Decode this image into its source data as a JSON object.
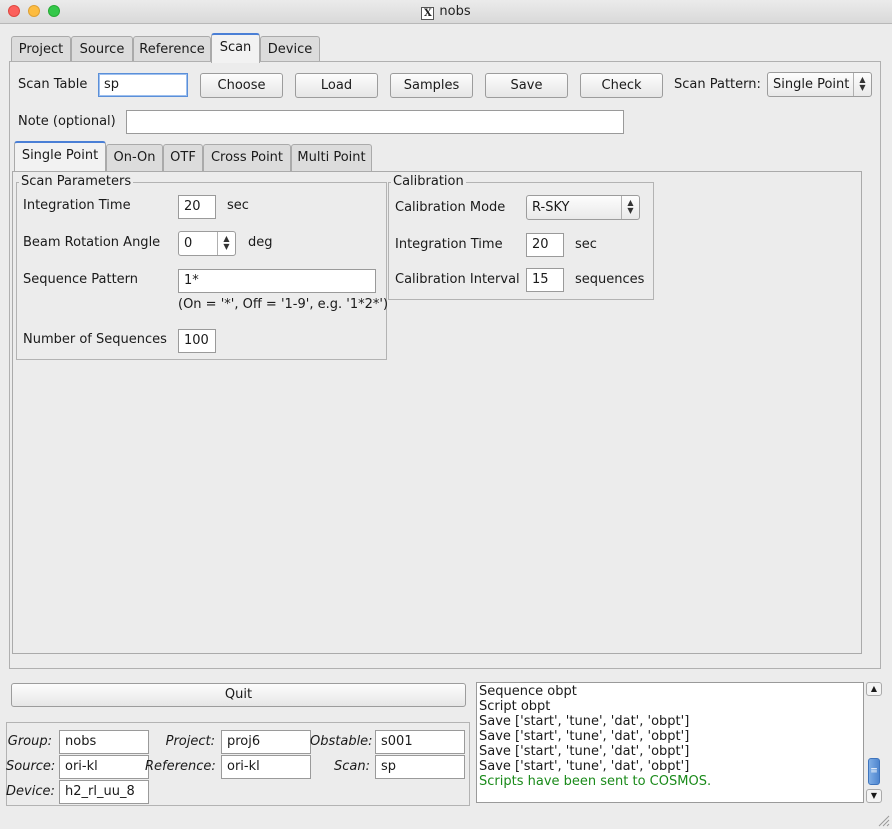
{
  "window": {
    "title": "nobs",
    "app_icon": "x11-icon"
  },
  "main_tabs": [
    "Project",
    "Source",
    "Reference",
    "Scan",
    "Device"
  ],
  "active_main_tab": "Scan",
  "scan_table": {
    "label": "Scan Table",
    "value": "sp",
    "buttons": [
      "Choose",
      "Load",
      "Samples",
      "Save",
      "Check"
    ],
    "pattern_label": "Scan Pattern:",
    "pattern_value": "Single Point"
  },
  "note": {
    "label": "Note (optional)",
    "value": ""
  },
  "sub_tabs": [
    "Single Point",
    "On-On",
    "OTF",
    "Cross Point",
    "Multi Point"
  ],
  "active_sub_tab": "Single Point",
  "scan_parameters": {
    "title": "Scan Parameters",
    "integration_time_label": "Integration Time",
    "integration_time_value": "20",
    "integration_time_unit": "sec",
    "beam_rotation_label": "Beam Rotation Angle",
    "beam_rotation_value": "0",
    "beam_rotation_unit": "deg",
    "sequence_pattern_label": "Sequence Pattern",
    "sequence_pattern_value": "1*",
    "sequence_pattern_hint": "(On = '*', Off = '1-9', e.g. '1*2*')",
    "num_sequences_label": "Number of Sequences",
    "num_sequences_value": "100"
  },
  "calibration": {
    "title": "Calibration",
    "mode_label": "Calibration Mode",
    "mode_value": "R-SKY",
    "integration_time_label": "Integration Time",
    "integration_time_value": "20",
    "integration_time_unit": "sec",
    "interval_label": "Calibration Interval",
    "interval_value": "15",
    "interval_unit": "sequences"
  },
  "quit_label": "Quit",
  "status": {
    "group_label": "Group:",
    "group_value": "nobs",
    "project_label": "Project:",
    "project_value": "proj6",
    "obstable_label": "Obstable:",
    "obstable_value": "s001",
    "source_label": "Source:",
    "source_value": "ori-kl",
    "reference_label": "Reference:",
    "reference_value": "ori-kl",
    "scan_label": "Scan:",
    "scan_value": "sp",
    "device_label": "Device:",
    "device_value": "h2_rl_uu_8"
  },
  "log": {
    "lines": [
      "Sequence obpt",
      "Script obpt",
      "Save ['start', 'tune', 'dat', 'obpt']",
      "Save ['start', 'tune', 'dat', 'obpt']",
      "Save ['start', 'tune', 'dat', 'obpt']",
      "Save ['start', 'tune', 'dat', 'obpt']"
    ],
    "success_line": "Scripts have been sent to COSMOS.",
    "success_color": "#1a8a1a"
  },
  "colors": {
    "accent": "#4a7fd6",
    "focus": "#5b8fd8"
  }
}
